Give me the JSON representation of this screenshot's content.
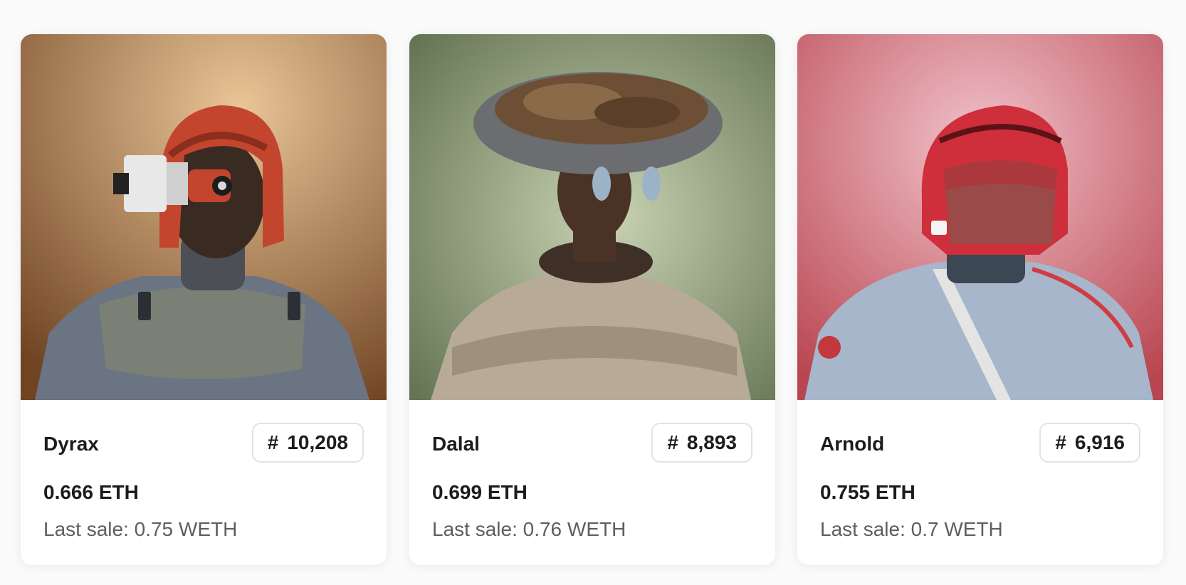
{
  "cards": [
    {
      "portrait_icon": "helmet-cyclops-portrait",
      "name": "Dyrax",
      "hash": "#",
      "token_number": "10,208",
      "price": "0.666 ETH",
      "last_sale": "Last sale: 0.75 WETH",
      "colors": {
        "bg_light": "#e9c597",
        "bg_dark": "#6f4423",
        "helmet": "#c4452d",
        "suit": "#6a7482",
        "skin": "#3a2b22"
      }
    },
    {
      "portrait_icon": "woven-hat-portrait",
      "name": "Dalal",
      "hash": "#",
      "token_number": "8,893",
      "price": "0.699 ETH",
      "last_sale": "Last sale: 0.76 WETH",
      "colors": {
        "bg_light": "#c8d2b3",
        "bg_dark": "#5a6b49",
        "hat": "#6b6d70",
        "cloak": "#b7ab98",
        "skin": "#4a3326"
      }
    },
    {
      "portrait_icon": "red-visor-helmet-portrait",
      "name": "Arnold",
      "hash": "#",
      "token_number": "6,916",
      "price": "0.755 ETH",
      "last_sale": "Last sale: 0.7 WETH",
      "colors": {
        "bg_light": "#f1c2cb",
        "bg_dark": "#b8454f",
        "helmet": "#cf2f3a",
        "suit": "#a7b6cb",
        "skin": "#9a4a48"
      }
    }
  ]
}
